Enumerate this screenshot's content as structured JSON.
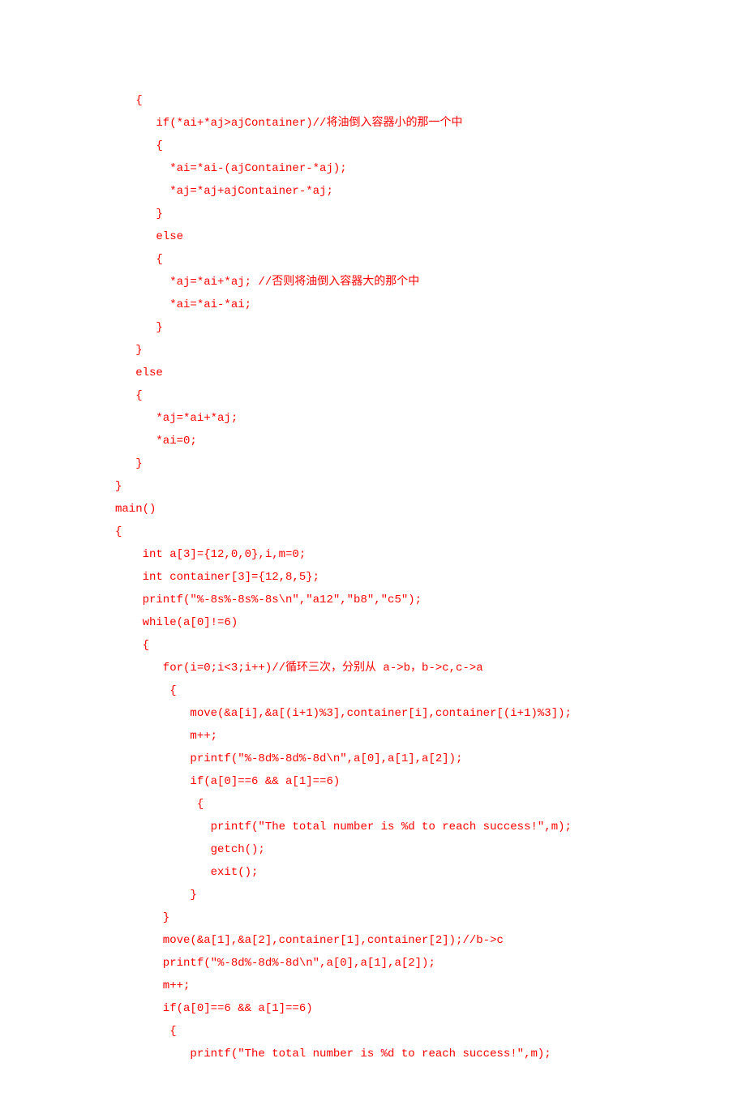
{
  "code": {
    "lines": [
      "   {",
      "      if(*ai+*aj>ajContainer)//将油倒入容器小的那一个中",
      "      {",
      "        *ai=*ai-(ajContainer-*aj);",
      "        *aj=*aj+ajContainer-*aj;",
      "      }",
      "      else",
      "      {",
      "        *aj=*ai+*aj; //否则将油倒入容器大的那个中",
      "        *ai=*ai-*ai;",
      "      }",
      "   }",
      "   else",
      "   {",
      "      *aj=*ai+*aj;",
      "      *ai=0;",
      "   }",
      "}",
      "",
      "main()",
      "{",
      "    int a[3]={12,0,0},i,m=0;",
      "    int container[3]={12,8,5};",
      "    printf(\"%-8s%-8s%-8s\\n\",\"a12\",\"b8\",\"c5\");",
      "    while(a[0]!=6)",
      "    {",
      "       for(i=0;i<3;i++)//循环三次，分别从 a->b，b->c,c->a",
      "        {",
      "           move(&a[i],&a[(i+1)%3],container[i],container[(i+1)%3]);",
      "           m++;",
      "           printf(\"%-8d%-8d%-8d\\n\",a[0],a[1],a[2]);",
      "           if(a[0]==6 && a[1]==6)",
      "            {",
      "              printf(\"The total number is %d to reach success!\",m);",
      "              getch();",
      "              exit();",
      "           }",
      "       }",
      "       move(&a[1],&a[2],container[1],container[2]);//b->c",
      "       printf(\"%-8d%-8d%-8d\\n\",a[0],a[1],a[2]);",
      "       m++;",
      "       if(a[0]==6 && a[1]==6)",
      "        {",
      "           printf(\"The total number is %d to reach success!\",m);"
    ]
  }
}
